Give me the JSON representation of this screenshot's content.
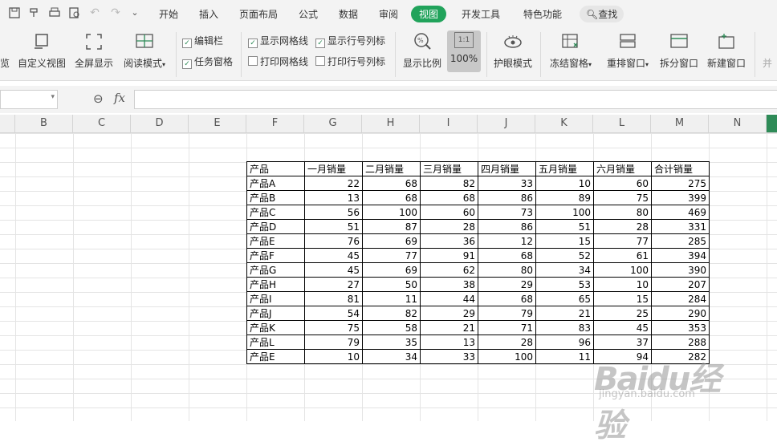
{
  "menu": {
    "tabs": [
      "开始",
      "插入",
      "页面布局",
      "公式",
      "数据",
      "审阅",
      "视图",
      "开发工具",
      "特色功能"
    ],
    "active_tab": "视图",
    "search_label": "查找"
  },
  "ribbon": {
    "partial_left_label": "览",
    "custom_view": "自定义视图",
    "fullscreen": "全屏显示",
    "reading_mode": "阅读模式",
    "edit_bar": "编辑栏",
    "task_pane": "任务窗格",
    "show_gridlines": "显示网格线",
    "print_gridlines": "打印网格线",
    "show_headers": "显示行号列标",
    "print_headers": "打印行号列标",
    "zoom_ratio": "显示比例",
    "zoom_100": "100%",
    "zoom_100_icon_text": "1:1",
    "eye_care": "护眼模式",
    "freeze_panes": "冻结窗格",
    "arrange_windows": "重排窗口",
    "split_window": "拆分窗口",
    "new_window": "新建窗口",
    "partial_right_label": "并"
  },
  "formula": {
    "fx": "fx"
  },
  "columns": [
    "B",
    "C",
    "D",
    "E",
    "F",
    "G",
    "H",
    "I",
    "J",
    "K",
    "L",
    "M",
    "N"
  ],
  "table": {
    "headers": [
      "产品",
      "一月销量",
      "二月销量",
      "三月销量",
      "四月销量",
      "五月销量",
      "六月销量",
      "合计销量"
    ],
    "rows": [
      [
        "产品A",
        "22",
        "68",
        "82",
        "33",
        "10",
        "60",
        "275"
      ],
      [
        "产品B",
        "13",
        "68",
        "68",
        "86",
        "89",
        "75",
        "399"
      ],
      [
        "产品C",
        "56",
        "100",
        "60",
        "73",
        "100",
        "80",
        "469"
      ],
      [
        "产品D",
        "51",
        "87",
        "28",
        "86",
        "51",
        "28",
        "331"
      ],
      [
        "产品E",
        "76",
        "69",
        "36",
        "12",
        "15",
        "77",
        "285"
      ],
      [
        "产品F",
        "45",
        "77",
        "91",
        "68",
        "52",
        "61",
        "394"
      ],
      [
        "产品G",
        "45",
        "69",
        "62",
        "80",
        "34",
        "100",
        "390"
      ],
      [
        "产品H",
        "27",
        "50",
        "38",
        "29",
        "53",
        "10",
        "207"
      ],
      [
        "产品I",
        "81",
        "11",
        "44",
        "68",
        "65",
        "15",
        "284"
      ],
      [
        "产品J",
        "54",
        "82",
        "29",
        "79",
        "21",
        "25",
        "290"
      ],
      [
        "产品K",
        "75",
        "58",
        "21",
        "71",
        "83",
        "45",
        "353"
      ],
      [
        "产品L",
        "79",
        "35",
        "13",
        "28",
        "96",
        "37",
        "288"
      ],
      [
        "产品E",
        "10",
        "34",
        "33",
        "100",
        "11",
        "94",
        "282"
      ]
    ]
  },
  "watermark": {
    "main": "Baidu经验",
    "sub": "jingyan.baidu.com"
  }
}
